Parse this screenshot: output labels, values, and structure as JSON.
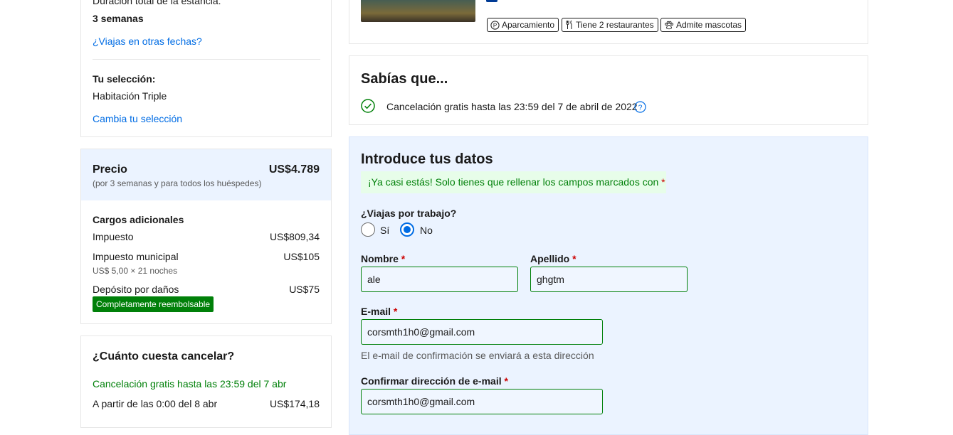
{
  "summary": {
    "duration_label": "Duración total de la estancia:",
    "duration_value": "3 semanas",
    "other_dates_link": "¿Viajas en otras fechas?",
    "selection_label": "Tu selección:",
    "selection_value": "Habitación Triple",
    "change_selection_link": "Cambia tu selección"
  },
  "price": {
    "title": "Precio",
    "total": "US$4.789",
    "subtitle": "(por 3 semanas y para todos los huéspedes)",
    "extra_title": "Cargos adicionales",
    "lines": [
      {
        "label": "Impuesto",
        "amount": "US$809,34",
        "detail": ""
      },
      {
        "label": "Impuesto municipal",
        "amount": "US$105",
        "detail": "US$ 5,00 × 21 noches"
      },
      {
        "label": "Depósito por daños",
        "amount": "US$75",
        "detail": ""
      }
    ],
    "refundable_badge": "Completamente reembolsable"
  },
  "cancel_cost": {
    "title": "¿Cuánto cuesta cancelar?",
    "free_until": "Cancelación gratis hasta las 23:59 del 7 abr",
    "from_label": "A partir de las 0:00 del 8 abr",
    "from_amount": "US$174,18"
  },
  "hotel": {
    "facilities": [
      "Aparcamiento",
      "Tiene 2 restaurantes",
      "Admite mascotas"
    ]
  },
  "did_you_know": {
    "title": "Sabías que...",
    "item": "Cancelación gratis hasta las 23:59 del 7 de abril de 2022"
  },
  "form": {
    "title": "Introduce tus datos",
    "notice": "¡Ya casi estás! Solo tienes que rellenar los campos marcados con",
    "required_mark": "*",
    "business_question": "¿Viajas por trabajo?",
    "business_yes": "Sí",
    "business_no": "No",
    "first_name_label": "Nombre",
    "first_name_value": "ale",
    "last_name_label": "Apellido",
    "last_name_value": "ghgtm",
    "email_label": "E-mail",
    "email_value": "corsmth1h0@gmail.com",
    "email_hint": "El e-mail de confirmación se enviará a esta dirección",
    "confirm_email_label": "Confirmar dirección de e-mail",
    "confirm_email_value": "corsmth1h0@gmail.com"
  },
  "colors": {
    "link": "#006ce4",
    "success": "#008009",
    "required": "#cc0000",
    "form_bg": "#ebf3ff"
  }
}
